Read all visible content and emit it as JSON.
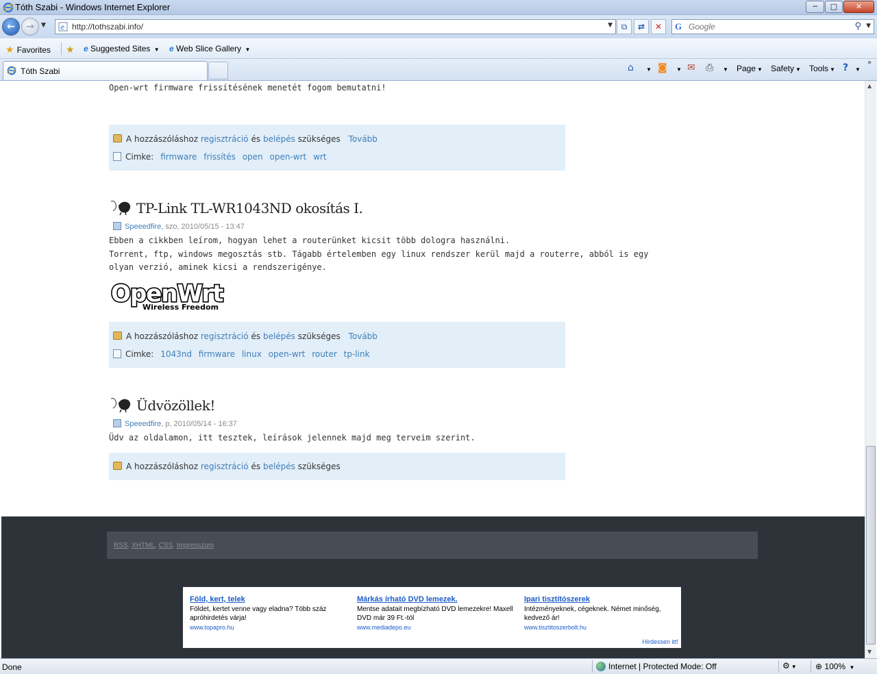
{
  "window": {
    "title": "Tóth Szabi - Windows Internet Explorer",
    "minimize": "─",
    "maximize": "□",
    "close": "✕"
  },
  "navigation": {
    "url": "http://tothszabi.info/",
    "search_placeholder": "Google"
  },
  "favorites_bar": {
    "favorites_label": "Favorites",
    "items": [
      {
        "label": "Suggested Sites"
      },
      {
        "label": "Web Slice Gallery"
      }
    ]
  },
  "tabs": [
    {
      "label": "Tóth Szabi",
      "active": true
    }
  ],
  "command_bar": {
    "page": "Page",
    "safety": "Safety",
    "tools": "Tools"
  },
  "content": {
    "intro_text": "Open-wrt firmware frissítésének menetét fogom bemutatni!",
    "meta_common": {
      "prefix": "A hozzászóláshoz",
      "register": "regisztráció",
      "and": "és",
      "login": "belépés",
      "required": "szükséges",
      "more": "Tovább",
      "tags_label": "Cimke:"
    },
    "post0_tags": [
      "firmware",
      "frissítés",
      "open",
      "open-wrt",
      "wrt"
    ],
    "posts": [
      {
        "title": "TP-Link TL-WR1043ND okosítás I.",
        "author": "Speeedfire",
        "date": ", szo, 2010/05/15 - 13:47",
        "body": [
          "Ebben a cikkben leírom, hogyan lehet a routerünket kicsit több dologra használni.",
          "Torrent, ftp, windows megosztás stb. Tágabb értelemben egy linux rendszer kerül majd a routerre, abból is egy",
          "olyan verzió, aminek kicsi a rendszerigénye."
        ],
        "logo_main": "OpenWrt",
        "logo_sub": "Wireless Freedom",
        "tags": [
          "1043nd",
          "firmware",
          "linux",
          "open-wrt",
          "router",
          "tp-link"
        ]
      },
      {
        "title": "Üdvözöllek!",
        "author": "Speeedfire",
        "date": ", p, 2010/05/14 - 16:37",
        "body": [
          "Üdv az oldalamon, itt tesztek, leírások jelennek majd meg terveim szerint."
        ]
      }
    ]
  },
  "footer": {
    "links": [
      "RSS",
      "XHTML",
      "CSS",
      "Impresszum"
    ]
  },
  "ads": {
    "items": [
      {
        "title": "Föld, kert, telek",
        "desc": "Földet, kertet venne vagy eladna? Több száz apróhirdetés várja!",
        "url": "www.topapro.hu"
      },
      {
        "title": "Márkás írható DVD lemezek.",
        "desc": "Mentse adatait megbízható DVD lemezekre! Maxell DVD már 39 Ft.-tól",
        "url": "www.mediadepo.eu"
      },
      {
        "title": "Ipari tisztítószerek",
        "desc": "Intézményeknek, cégeknek. Német minőség, kedvező ár!",
        "url": "www.tisztitoszerbolt.hu"
      }
    ],
    "cta": "Hirdessen itt!"
  },
  "status_bar": {
    "status": "Done",
    "zone": "Internet | Protected Mode: Off",
    "zoom": "100%"
  }
}
